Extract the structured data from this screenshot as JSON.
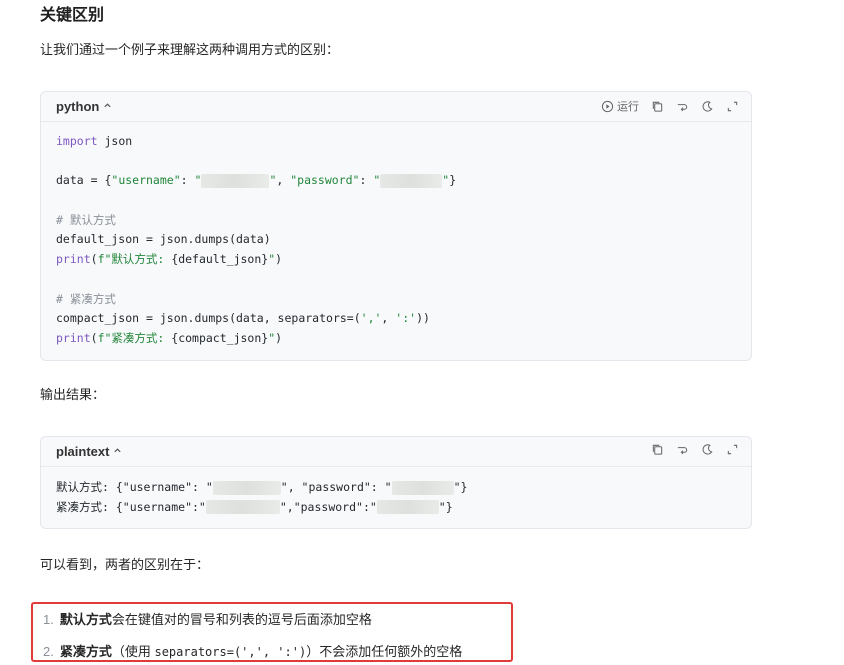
{
  "heading": "关键区别",
  "intro": "让我们通过一个例子来理解这两种调用方式的区别：",
  "code_block_1": {
    "language": "python",
    "run_label": "运行",
    "icons": [
      "play-icon",
      "copy-icon",
      "wrap-icon",
      "theme-icon",
      "expand-icon"
    ],
    "lines": {
      "l1_kw": "import",
      "l1_rest": " json",
      "l3_a": "data = {",
      "l3_k1": "\"username\"",
      "l3_b": ": ",
      "l3_q1": "\"",
      "l3_q2": "\"",
      "l3_c": ", ",
      "l3_k2": "\"password\"",
      "l3_d": ": ",
      "l3_q3": "\"",
      "l3_q4": "\"",
      "l3_e": "}",
      "l5": "# 默认方式",
      "l6": "default_json = json.dumps(data)",
      "l7_fn": "print",
      "l7_a": "(",
      "l7_s": "f\"默认方式: ",
      "l7_b": "{default_json}",
      "l7_c": "\"",
      "l7_d": ")",
      "l9": "# 紧凑方式",
      "l10_a": "compact_json = json.dumps(data, separators=(",
      "l10_s1": "','",
      "l10_b": ", ",
      "l10_s2": "':'",
      "l10_c": "))",
      "l11_fn": "print",
      "l11_a": "(",
      "l11_s": "f\"紧凑方式: ",
      "l11_b": "{compact_json}",
      "l11_c": "\"",
      "l11_d": ")"
    }
  },
  "output_label": "输出结果：",
  "code_block_2": {
    "language": "plaintext",
    "icons": [
      "copy-icon",
      "wrap-icon",
      "theme-icon",
      "expand-icon"
    ],
    "line1_a": "默认方式: {\"username\": \"",
    "line1_b": "\", \"password\": \"",
    "line1_c": "\"}",
    "line2_a": "紧凑方式: {\"username\":\"",
    "line2_b": "\",\"password\":\"",
    "line2_c": "\"}"
  },
  "summary": "可以看到，两者的区别在于：",
  "list": {
    "item1_num": "1.",
    "item1_bold": "默认方式",
    "item1_rest": "会在键值对的冒号和列表的逗号后面添加空格",
    "item2_num": "2.",
    "item2_bold": "紧凑方式",
    "item2_a": "（使用 ",
    "item2_code": "separators=(',', ':')",
    "item2_b": "）不会添加任何额外的空格"
  },
  "colors": {
    "highlight_border": "#e03a3a",
    "keyword": "#7d57c2",
    "string": "#22863a",
    "comment": "#8a8f98"
  }
}
